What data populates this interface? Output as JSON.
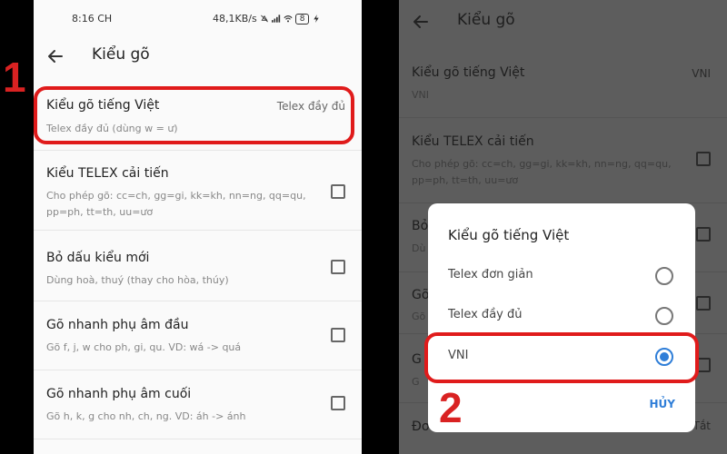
{
  "status_bar": {
    "time": "8:16 CH",
    "network_speed": "48,1KB/s",
    "battery": "8"
  },
  "screen": {
    "title": "Kiểu gõ"
  },
  "settings": [
    {
      "title": "Kiểu gõ tiếng Việt",
      "value": "Telex đầy đủ",
      "subtitle": "Telex đầy đủ (dùng w = ư)"
    },
    {
      "title": "Kiểu TELEX cải tiến",
      "subtitle": "Cho phép gõ: cc=ch, gg=gi, kk=kh, nn=ng, qq=qu, pp=ph, tt=th, uu=ươ",
      "checked": false
    },
    {
      "title": "Bỏ dấu kiểu mới",
      "subtitle": "Dùng hoà, thuý (thay cho hòa, thúy)",
      "checked": false
    },
    {
      "title": "Gõ nhanh phụ âm đầu",
      "subtitle": "Gõ f, j, w cho ph, gi, qu. VD: wá -> quá",
      "checked": false
    },
    {
      "title": "Gõ nhanh phụ âm cuối",
      "subtitle": "Gõ h, k, g cho nh, ch, ng. VD: áh -> ánh",
      "checked": false
    }
  ],
  "right_screen": {
    "title": "Kiểu gõ",
    "rows": [
      {
        "title": "Kiểu gõ tiếng Việt",
        "value": "VNI",
        "subtitle": "VNI"
      },
      {
        "title": "Kiểu TELEX cải tiến",
        "subtitle": "Cho phép gõ: cc=ch, gg=gi, kk=kh, nn=ng, qq=qu, pp=ph, tt=th, uu=ươ"
      },
      {
        "title_partial": "Bỏ",
        "subtitle_partial": "Dù"
      },
      {
        "title_partial": "Gõ",
        "subtitle_partial": "Gõ"
      },
      {
        "title_partial": "G",
        "subtitle_partial": "G"
      },
      {
        "title_partial": "Đơ",
        "value_partial": "Tắt"
      }
    ]
  },
  "dialog": {
    "title": "Kiểu gõ tiếng Việt",
    "options": [
      {
        "label": "Telex đơn giản",
        "selected": false
      },
      {
        "label": "Telex đầy đủ",
        "selected": false
      },
      {
        "label": "VNI",
        "selected": true
      }
    ],
    "cancel_label": "HỦY"
  },
  "annotations": {
    "step1": "1",
    "step2": "2",
    "highlight_color": "#e01b1b"
  },
  "icons": [
    "back-arrow-icon",
    "mute-icon",
    "signal-icon",
    "wifi-icon",
    "battery-icon",
    "charging-icon"
  ],
  "colors": {
    "accent": "#2f7ed8",
    "annotation": "#d92222"
  }
}
